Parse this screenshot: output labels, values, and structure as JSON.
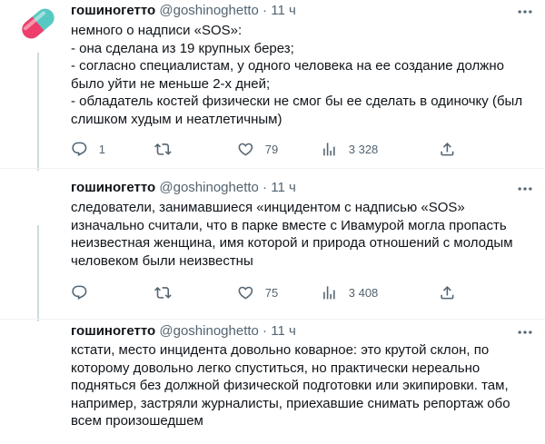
{
  "tweets": [
    {
      "author": {
        "name": "гошиногетто",
        "handle": "@goshinoghetto",
        "dot": "·",
        "time": "11 ч"
      },
      "lines": [
        "немного о надписи «SOS»:",
        "- она сделана из 19 крупных берез;",
        "- согласно специалистам, у одного человека на ее создание должно",
        "было уйти не меньше 2-х дней;",
        "- обладатель костей физически не смог бы ее сделать в одиночку (был",
        "слишком худым и неатлетичным)"
      ],
      "stats": {
        "replies": "1",
        "retweets": "",
        "likes": "79",
        "views": "3 328"
      }
    },
    {
      "author": {
        "name": "гошиногетто",
        "handle": "@goshinoghetto",
        "dot": "·",
        "time": "11 ч"
      },
      "lines": [
        "следователи, занимавшиеся «инцидентом с надписью «SOS»",
        "изначально считали, что в парке вместе с Ивамурой могла пропасть",
        "неизвестная женщина, имя которой и природа отношений с молодым",
        "человеком были неизвестны"
      ],
      "stats": {
        "replies": "",
        "retweets": "",
        "likes": "75",
        "views": "3 408"
      }
    },
    {
      "author": {
        "name": "гошиногетто",
        "handle": "@goshinoghetto",
        "dot": "·",
        "time": "11 ч"
      },
      "lines": [
        "кстати, место инцидента довольно коварное: это крутой склон, по",
        "которому довольно легко спуститься, но практически нереально",
        "подняться без должной физической подготовки или экипировки. там,",
        "например, застряли журналисты, приехавшие снимать репортаж обо",
        "всем произошедшем"
      ]
    }
  ],
  "icons": {
    "avatar": "pill-capsule-avatar",
    "more": "more-icon",
    "reply": "reply-icon",
    "retweet": "retweet-icon",
    "like": "heart-icon",
    "views": "views-icon",
    "share": "share-icon"
  },
  "colors": {
    "text": "#0f1419",
    "secondary": "#536471",
    "divider": "#eff3f4",
    "thread_line": "#cfd9de",
    "pill_red": "#ee3f6c",
    "pill_teal": "#57c9c2"
  }
}
